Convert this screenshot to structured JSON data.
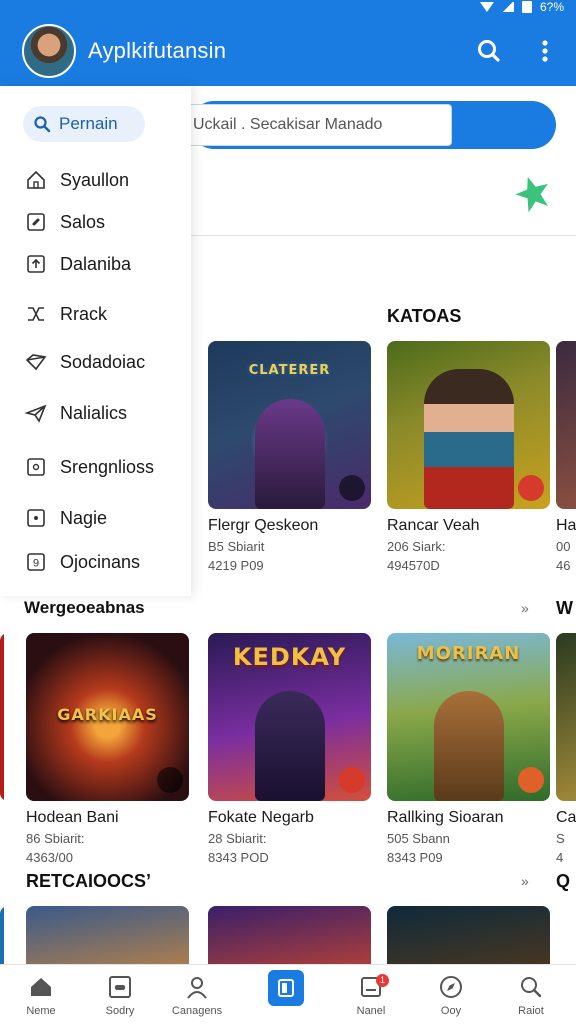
{
  "status": {
    "battery": "6?%"
  },
  "app": {
    "title": "Ayplkifutansin"
  },
  "appbar": {
    "search_icon": "search-icon",
    "more_icon": "more-vert-icon"
  },
  "drawer": {
    "search_label": "Pernain",
    "items": [
      {
        "label": "Syaullon",
        "icon": "home-icon"
      },
      {
        "label": "Salos",
        "icon": "tag-icon"
      },
      {
        "label": "Dalaniba",
        "icon": "upload-icon"
      },
      {
        "label": "Rrack",
        "icon": "shuffle-icon"
      },
      {
        "label": "Sodadoiac",
        "icon": "diamond-icon"
      },
      {
        "label": "Nalialics",
        "icon": "send-icon"
      },
      {
        "label": "Srengnlioss",
        "icon": "square-icon"
      },
      {
        "label": "Nagie",
        "icon": "square-dot-icon"
      },
      {
        "label": "Ojocinans",
        "icon": "number-9-icon"
      }
    ],
    "section_label": "Wergeoeabnas"
  },
  "search": {
    "placeholder": "Uckail . Secakisar Manado"
  },
  "sections": {
    "katoas": {
      "title": "KATOAS",
      "more": ""
    },
    "row2": {
      "more": "»"
    },
    "retcaioocs": {
      "title": "RETCAIOOCS’",
      "more": "»"
    }
  },
  "row1": [
    {
      "name": "Flergr Qeskeon",
      "line1": "B5 Sbiarit",
      "line2": "4219 P09",
      "logo": "CLATERER",
      "colors": [
        "#1d3a5c",
        "#4a2a6a",
        "#78c7ff"
      ]
    },
    {
      "name": "Rancar Veah",
      "line1": "206 Siark:",
      "line2": "494570D",
      "logo": "",
      "colors": [
        "#4c6b1b",
        "#c9a21e",
        "#b2281e"
      ]
    },
    {
      "name": "Ha",
      "line1": "00",
      "line2": "46",
      "logo": "",
      "colors": [
        "#3a2a40",
        "#6a4a5a",
        "#a05a40"
      ]
    }
  ],
  "row2": [
    {
      "name": "Hodean Bani",
      "line1": "86 Sbiarit:",
      "line2": "4363/00",
      "logo": "GARKIAAS",
      "colors": [
        "#2a0e12",
        "#b53a1c",
        "#f3a43a"
      ]
    },
    {
      "name": "Fokate Negarb",
      "line1": "28 Sbiarit:",
      "line2": "8343 POD",
      "logo": "KEDKAY",
      "colors": [
        "#2a1a55",
        "#7a2ea0",
        "#f0c040"
      ]
    },
    {
      "name": "Rallking Sioaran",
      "line1": "505 Sbann",
      "line2": "8343 P09",
      "logo": "MORIRAN",
      "colors": [
        "#2f6b2a",
        "#8aa84a",
        "#e8c24a"
      ]
    },
    {
      "name": "Ca",
      "line1": "S",
      "line2": "4",
      "logo": "",
      "colors": [
        "#2a3a20",
        "#6a8a3a",
        "#c0a040"
      ]
    }
  ],
  "row2_partial_left": {
    "colors": [
      "#b51d1d"
    ]
  },
  "row3": [
    {
      "colors": [
        "#3a5a8a",
        "#d28a3a",
        "#f5c36a"
      ]
    },
    {
      "colors": [
        "#3a1f6a",
        "#d24a2a",
        "#f8a53a"
      ]
    },
    {
      "colors": [
        "#0f2a3a",
        "#5a3a1a",
        "#c87a3a"
      ]
    }
  ],
  "bottomnav": [
    {
      "label": "Neme",
      "icon": "home-icon"
    },
    {
      "label": "Sodry",
      "icon": "gamepad-icon"
    },
    {
      "label": "Canagens",
      "icon": "user-icon"
    },
    {
      "label": "",
      "icon": "tablet-icon"
    },
    {
      "label": "Nanel",
      "icon": "notification-icon",
      "badge": "1"
    },
    {
      "label": "Ooy",
      "icon": "compass-icon"
    },
    {
      "label": "Raiot",
      "icon": "search-icon"
    }
  ],
  "colors": {
    "primary": "#1a7be0",
    "accent_green": "#3bc27b",
    "badge_red": "#e53935"
  }
}
